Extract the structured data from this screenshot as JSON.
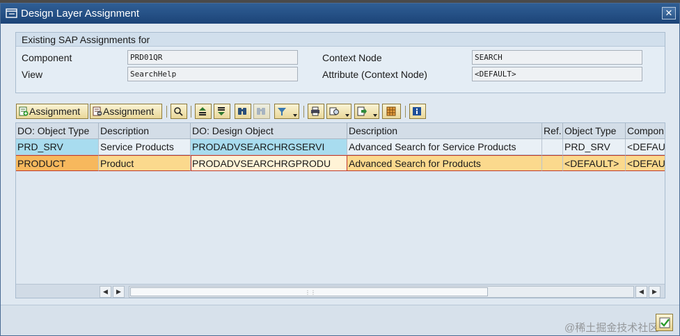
{
  "window": {
    "title": "Design Layer Assignment",
    "close_label": "✕"
  },
  "assignments": {
    "header": "Existing SAP Assignments for",
    "component_label": "Component",
    "component_value": "PRD01QR",
    "view_label": "View",
    "view_value": "SearchHelp",
    "context_node_label": "Context Node",
    "context_node_value": "SEARCH",
    "attribute_label": "Attribute (Context Node)",
    "attribute_value": "<DEFAULT>"
  },
  "toolbar": {
    "add_assignment_label": "Assignment",
    "remove_assignment_label": "Assignment",
    "icons": [
      "details-icon",
      "sort-ascending-icon",
      "sort-descending-icon",
      "find-icon",
      "find-next-icon",
      "filter-icon",
      "print-icon",
      "views-icon",
      "export-icon",
      "layout-icon",
      "info-icon"
    ]
  },
  "table": {
    "columns": [
      "DO: Object Type",
      "Description",
      "DO: Design Object",
      "Description",
      "Ref.",
      "Object Type",
      "Compon"
    ],
    "rows": [
      [
        "PRD_SRV",
        "Service Products",
        "PRODADVSEARCHRGSERVI",
        "Advanced Search for Service Products",
        "",
        "PRD_SRV",
        "<DEFAU"
      ],
      [
        "PRODUCT",
        "Product",
        "PRODADVSEARCHRGPRODU",
        "Advanced Search for Products",
        "",
        "<DEFAULT>",
        "<DEFAU"
      ]
    ]
  },
  "scrollbar": {
    "left_arrow": "◀",
    "right_arrow": "▶",
    "grip": "⋮⋮"
  },
  "footer": {
    "watermark": "@稀土掘金技术社区"
  },
  "colors": {
    "titlebar": "#1c4478",
    "selected_row": "#fbd98d",
    "key_cell_blue": "#a8dcef"
  }
}
